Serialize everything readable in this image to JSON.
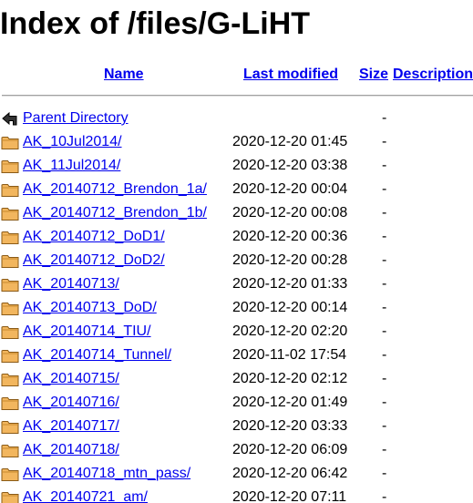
{
  "title": "Index of /files/G-LiHT",
  "headers": {
    "name": "Name",
    "last_modified": "Last modified",
    "size": "Size",
    "description": "Description"
  },
  "parent": {
    "label": "Parent Directory",
    "size": "-",
    "icon": "back-icon"
  },
  "entries": [
    {
      "name": "AK_10Jul2014/",
      "modified": "2020-12-20 01:45",
      "size": "-",
      "icon": "folder-icon"
    },
    {
      "name": "AK_11Jul2014/",
      "modified": "2020-12-20 03:38",
      "size": "-",
      "icon": "folder-icon"
    },
    {
      "name": "AK_20140712_Brendon_1a/",
      "modified": "2020-12-20 00:04",
      "size": "-",
      "icon": "folder-icon"
    },
    {
      "name": "AK_20140712_Brendon_1b/",
      "modified": "2020-12-20 00:08",
      "size": "-",
      "icon": "folder-icon"
    },
    {
      "name": "AK_20140712_DoD1/",
      "modified": "2020-12-20 00:36",
      "size": "-",
      "icon": "folder-icon"
    },
    {
      "name": "AK_20140712_DoD2/",
      "modified": "2020-12-20 00:28",
      "size": "-",
      "icon": "folder-icon"
    },
    {
      "name": "AK_20140713/",
      "modified": "2020-12-20 01:33",
      "size": "-",
      "icon": "folder-icon"
    },
    {
      "name": "AK_20140713_DoD/",
      "modified": "2020-12-20 00:14",
      "size": "-",
      "icon": "folder-icon"
    },
    {
      "name": "AK_20140714_TIU/",
      "modified": "2020-12-20 02:20",
      "size": "-",
      "icon": "folder-icon"
    },
    {
      "name": "AK_20140714_Tunnel/",
      "modified": "2020-11-02 17:54",
      "size": "-",
      "icon": "folder-icon"
    },
    {
      "name": "AK_20140715/",
      "modified": "2020-12-20 02:12",
      "size": "-",
      "icon": "folder-icon"
    },
    {
      "name": "AK_20140716/",
      "modified": "2020-12-20 01:49",
      "size": "-",
      "icon": "folder-icon"
    },
    {
      "name": "AK_20140717/",
      "modified": "2020-12-20 03:33",
      "size": "-",
      "icon": "folder-icon"
    },
    {
      "name": "AK_20140718/",
      "modified": "2020-12-20 06:09",
      "size": "-",
      "icon": "folder-icon"
    },
    {
      "name": "AK_20140718_mtn_pass/",
      "modified": "2020-12-20 06:42",
      "size": "-",
      "icon": "folder-icon"
    },
    {
      "name": "AK_20140721_am/",
      "modified": "2020-12-20 07:11",
      "size": "-",
      "icon": "folder-icon"
    }
  ],
  "colors": {
    "link": "#0000ee",
    "folder_fill": "#f2b65e",
    "folder_stroke": "#8a5a16"
  }
}
